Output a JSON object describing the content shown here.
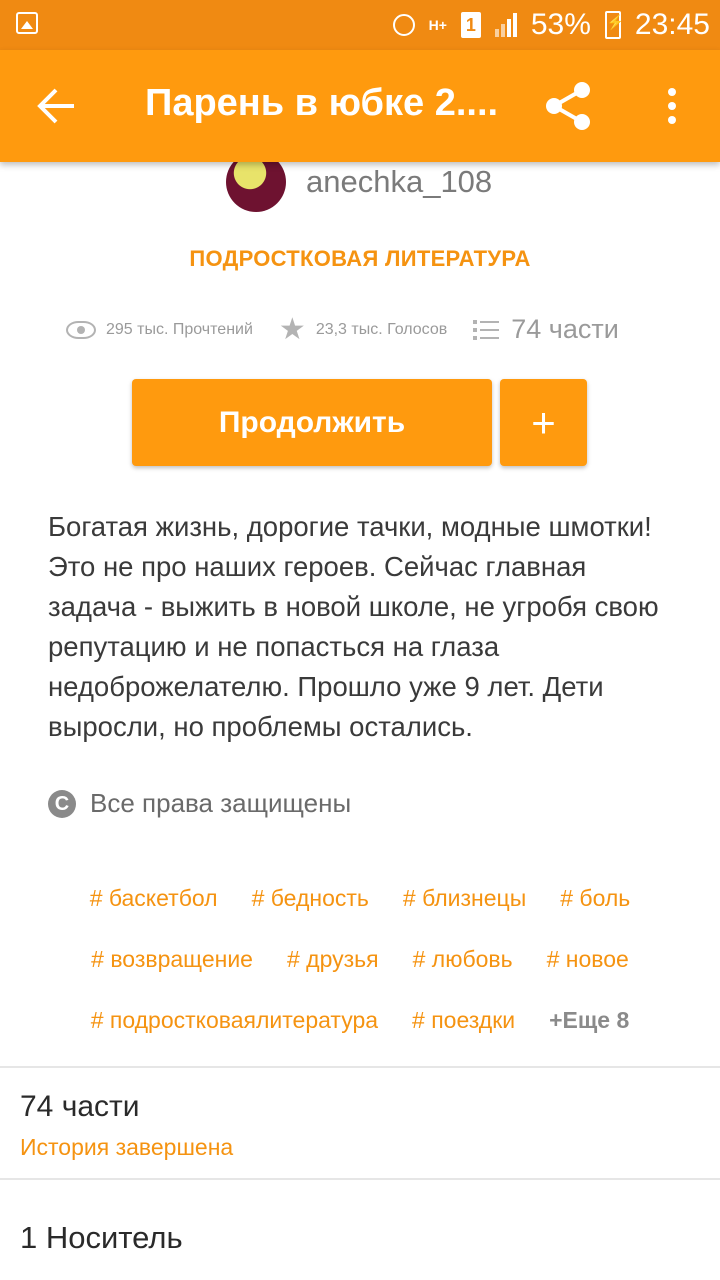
{
  "status_bar": {
    "battery": "53%",
    "time": "23:45",
    "network": "H+",
    "sim": "1"
  },
  "appbar": {
    "title": "Парень в юбке 2...."
  },
  "story": {
    "author": "anechka_108",
    "genre": "ПОДРОСТКОВАЯ ЛИТЕРАТУРА",
    "reads": "295 тыс. Прочтений",
    "votes": "23,3 тыс. Голосов",
    "parts": "74 части",
    "continue_label": "Продолжить",
    "add_label": "+",
    "description": "Богатая жизнь, дорогие тачки, модные шмотки! Это не про наших героев. Сейчас главная задача - выжить в новой школе, не угробя свою репутацию и не попасться на глаза недоброжелателю. Прошло уже 9 лет. Дети выросли, но проблемы остались.",
    "copyright": "Все права защищены"
  },
  "tags": {
    "row1": [
      "# баскетбол",
      "# бедность",
      "# близнецы",
      "# боль"
    ],
    "row2": [
      "# возвращение",
      "# друзья",
      "# любовь",
      "# новое"
    ],
    "row3": [
      "# подростковаялитература",
      "# поездки"
    ],
    "more": "+Еще 8"
  },
  "sections": {
    "parts_title": "74 части",
    "parts_status": "История завершена",
    "carrier": "1 Носитель"
  },
  "colors": {
    "accent": "#ff9a0e",
    "status_bar": "#f08a12",
    "tag": "#f59311"
  }
}
